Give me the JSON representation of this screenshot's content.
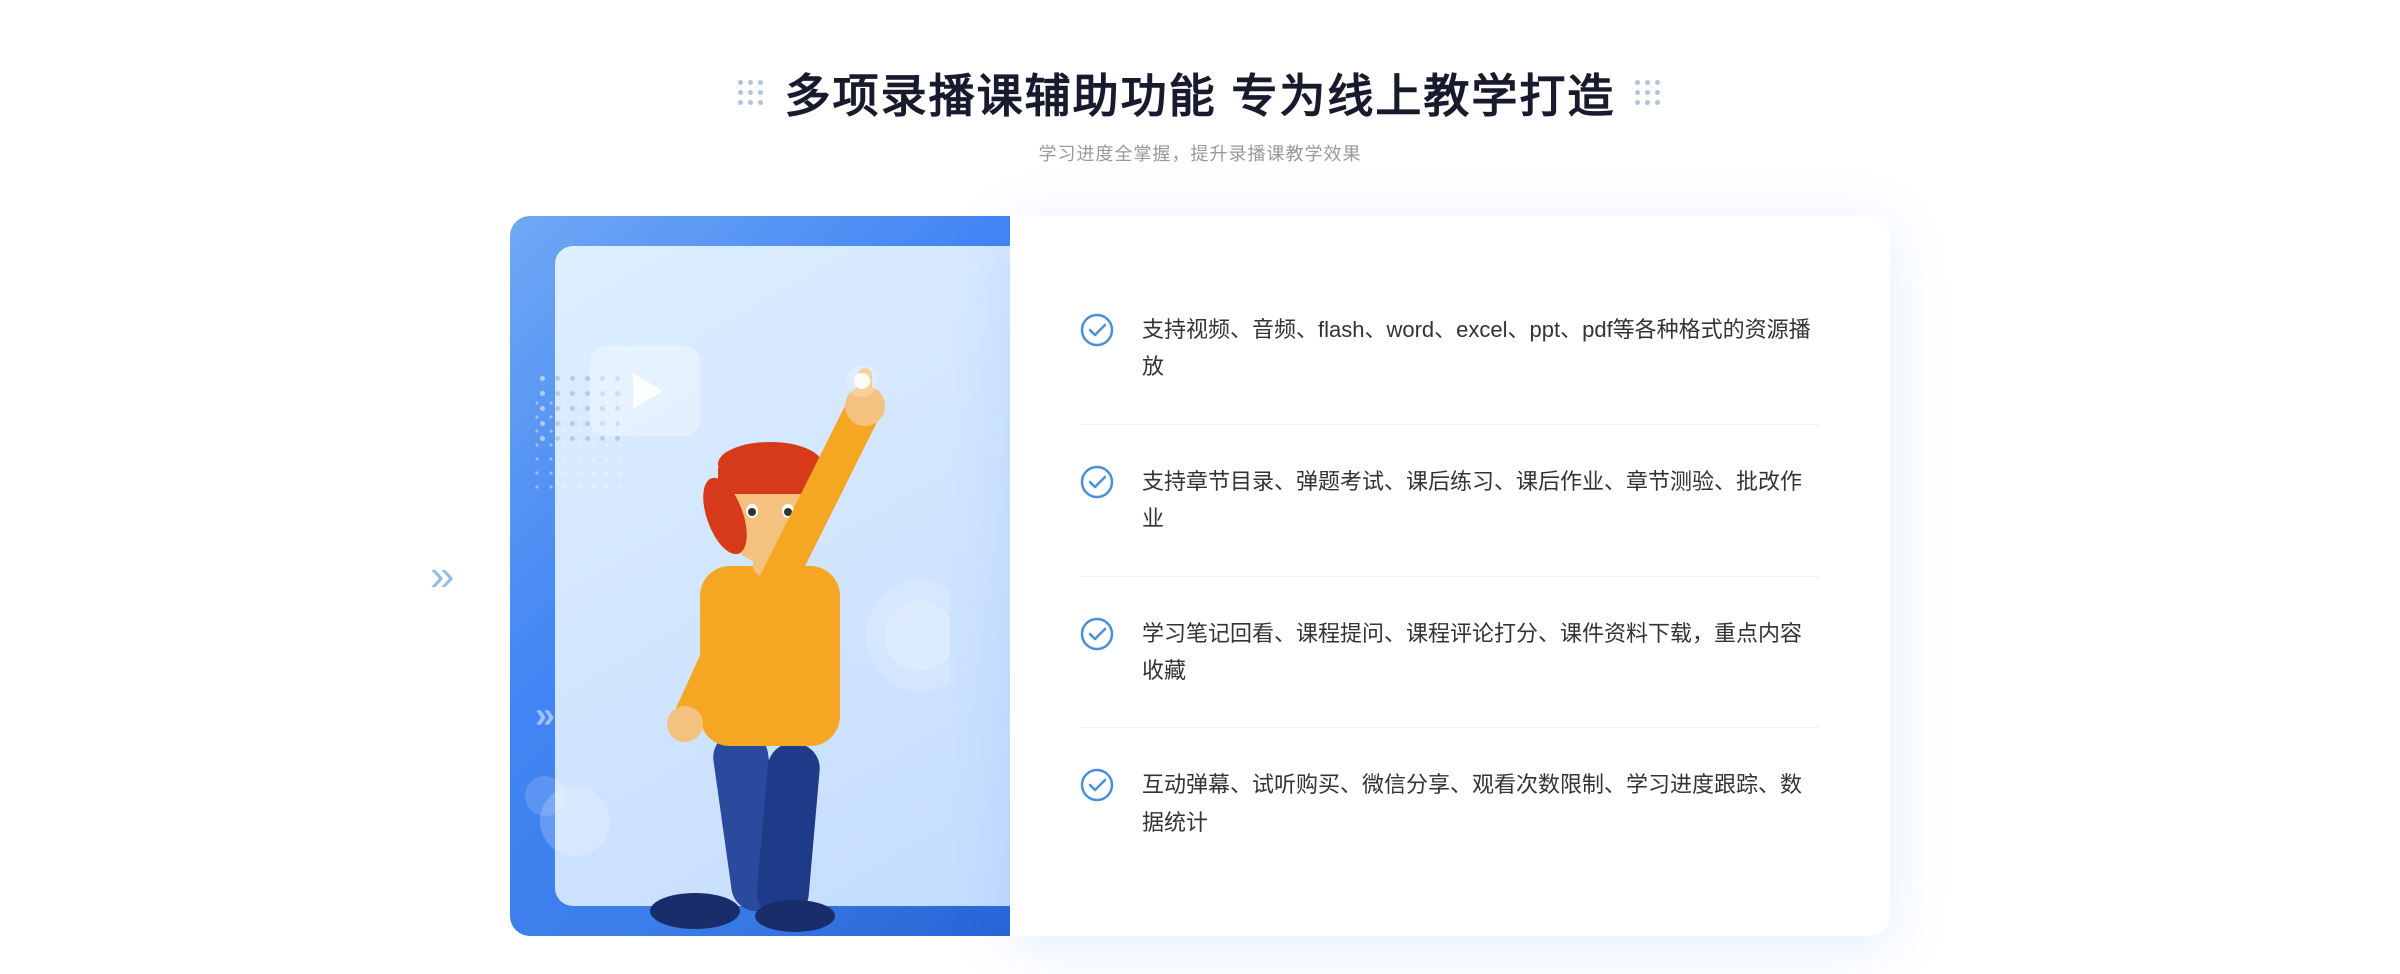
{
  "header": {
    "main_title": "多项录播课辅助功能 专为线上教学打造",
    "sub_title": "学习进度全掌握，提升录播课教学效果"
  },
  "features": [
    {
      "id": 1,
      "text": "支持视频、音频、flash、word、excel、ppt、pdf等各种格式的资源播放"
    },
    {
      "id": 2,
      "text": "支持章节目录、弹题考试、课后练习、课后作业、章节测验、批改作业"
    },
    {
      "id": 3,
      "text": "学习笔记回看、课程提问、课程评论打分、课件资料下载，重点内容收藏"
    },
    {
      "id": 4,
      "text": "互动弹幕、试听购买、微信分享、观看次数限制、学习进度跟踪、数据统计"
    }
  ],
  "icons": {
    "check_circle": "✓",
    "play": "▶",
    "chevron": "»"
  },
  "colors": {
    "primary_blue": "#4285f4",
    "light_blue": "#6fa8f5",
    "dark_blue": "#2563d4",
    "text_dark": "#1a1a2e",
    "text_gray": "#999999",
    "text_body": "#333333",
    "border_light": "#f0f4fa",
    "bg_white": "#ffffff",
    "check_color": "#4a90d9"
  }
}
